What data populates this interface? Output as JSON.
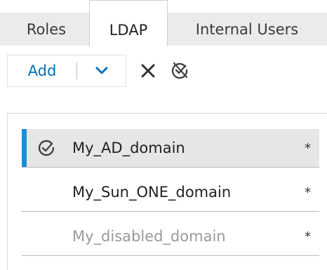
{
  "tabs": {
    "roles": "Roles",
    "ldap": "LDAP",
    "internal_users": "Internal Users",
    "active": "LDAP"
  },
  "toolbar": {
    "add_label": "Add",
    "dropdown_icon": "chevron-down-icon",
    "delete_icon": "close-icon",
    "toggle_icon": "disable-check-icon"
  },
  "colors": {
    "accent": "#1a8fd4",
    "link_blue": "#0073b7",
    "selected_row_bg": "#e6e6e6",
    "disabled_text": "#9a9a9a"
  },
  "domains": [
    {
      "name": "My_AD_domain",
      "marker": "*",
      "selected": true,
      "enabled": true,
      "icon": "check-circle-icon"
    },
    {
      "name": "My_Sun_ONE_domain",
      "marker": "*",
      "selected": false,
      "enabled": true
    },
    {
      "name": "My_disabled_domain",
      "marker": "*",
      "selected": false,
      "enabled": false
    }
  ]
}
